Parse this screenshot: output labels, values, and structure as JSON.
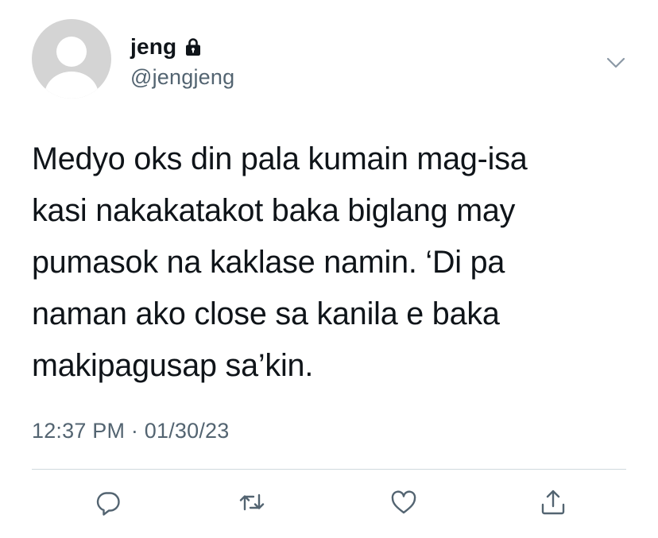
{
  "user": {
    "display_name": "jeng",
    "handle": "@jengjeng",
    "protected_icon": "lock-icon"
  },
  "tweet": {
    "text": "Medyo oks din pala kumain mag-isa\nkasi nakakatakot baka biglang may\npumasok na kaklase namin. ‘Di pa\nnaman ako close sa kanila e baka\nmakipagusap sa’kin.",
    "time": "12:37 PM",
    "separator": "·",
    "date": "01/30/23"
  },
  "actions": {
    "reply_icon": "reply-icon",
    "retweet_icon": "retweet-icon",
    "like_icon": "heart-icon",
    "share_icon": "share-icon",
    "more_icon": "chevron-down-icon"
  },
  "colors": {
    "text": "#0f1419",
    "secondary": "#536471",
    "divider": "#cfd9de",
    "avatar_bg": "#d4d4d4"
  }
}
